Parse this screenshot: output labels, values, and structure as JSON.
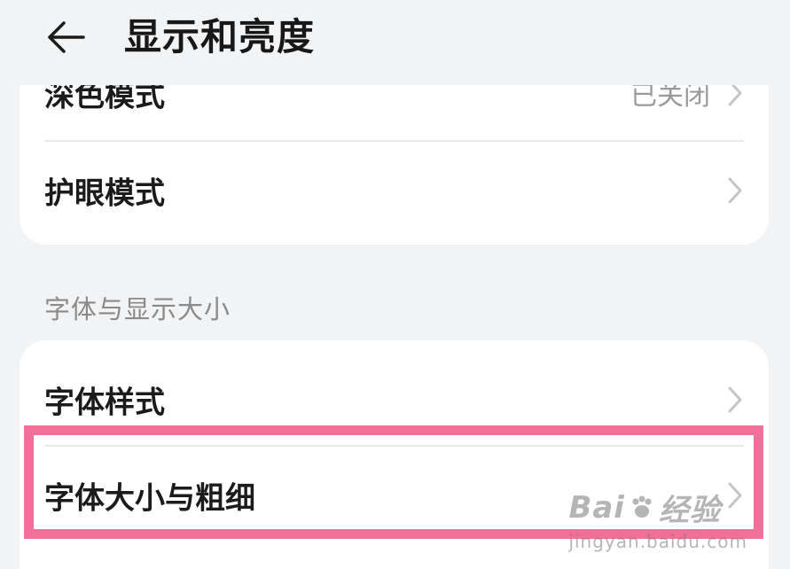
{
  "header": {
    "title": "显示和亮度"
  },
  "card1": {
    "rows": [
      {
        "label": "深色模式",
        "value": "已关闭"
      },
      {
        "label": "护眼模式"
      }
    ]
  },
  "section": {
    "label": "字体与显示大小"
  },
  "card2": {
    "rows": [
      {
        "label": "字体样式"
      },
      {
        "label": "字体大小与粗细"
      }
    ]
  },
  "watermark": {
    "brand": "Bai",
    "brand_suffix": "经验",
    "domain": "jingyan.baidu.com"
  },
  "colors": {
    "highlight": "#f0709a",
    "page_background": "#f1f3f5",
    "card_background": "#ffffff"
  },
  "icons": {
    "back": "arrow-left-icon",
    "chevron": "chevron-right-icon",
    "watermark_logo": "paw-icon"
  }
}
